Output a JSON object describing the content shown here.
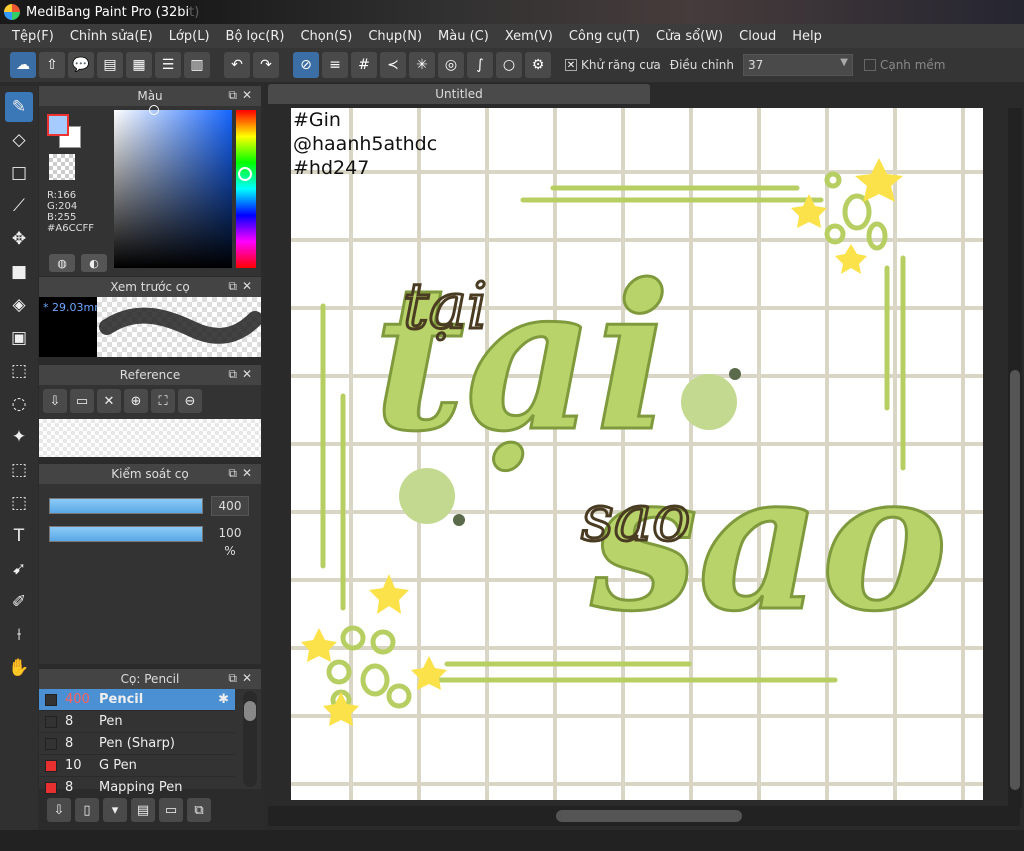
{
  "app": {
    "title": "MediBang Paint Pro (32bit)"
  },
  "menu": [
    "Tệp(F)",
    "Chỉnh sửa(E)",
    "Lớp(L)",
    "Bộ lọc(R)",
    "Chọn(S)",
    "Chụp(N)",
    "Màu (C)",
    "Xem(V)",
    "Công cụ(T)",
    "Cửa sổ(W)",
    "Cloud",
    "Help"
  ],
  "toolbar": {
    "antialias_label": "Khử răng cưa",
    "adjust_label": "Điều chỉnh",
    "adjust_value": "37",
    "soft_edge_label": "Cạnh mềm"
  },
  "color_panel": {
    "title": "Màu",
    "r": "R:166",
    "g": "G:204",
    "b": "B:255",
    "hex": "#A6CCFF",
    "current_color": "#A6CCFF"
  },
  "brush_preview": {
    "title": "Xem trước cọ",
    "size": "* 29.03mm"
  },
  "reference": {
    "title": "Reference"
  },
  "brush_control": {
    "title": "Kiểm soát cọ",
    "size_value": "400",
    "opacity_value": "100 %"
  },
  "brush_panel": {
    "title": "Cọ: Pencil",
    "items": [
      {
        "size": "400",
        "name": "Pencil",
        "color": "#333333"
      },
      {
        "size": "8",
        "name": "Pen",
        "color": "#333333"
      },
      {
        "size": "8",
        "name": "Pen (Sharp)",
        "color": "#333333"
      },
      {
        "size": "10",
        "name": "G Pen",
        "color": "#e83030"
      },
      {
        "size": "8",
        "name": "Mapping Pen",
        "color": "#e83030"
      }
    ]
  },
  "document": {
    "tab": "Untitled",
    "tags": [
      "#Gin",
      "@haanh5athdc",
      "#hd247"
    ],
    "word1": "tại",
    "word2": "sao",
    "script1": "tại",
    "script2": "sao"
  }
}
